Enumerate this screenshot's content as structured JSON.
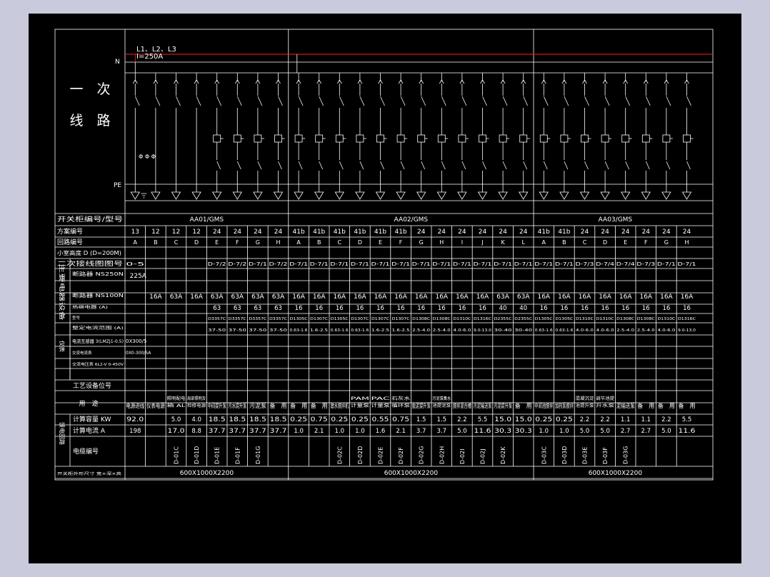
{
  "title_block": {
    "primary_circuit_line1": "一　次",
    "primary_circuit_line2": "线　路",
    "bus_phases": "L1、L2、L3",
    "bus_current": "I=250A",
    "n_label": "N",
    "pe_label": "PE",
    "meter_symbol": "Φ Φ Φ"
  },
  "row_labels": {
    "cabinet_no_type": "开关柜编号/型号",
    "scheme_no": "方案编号",
    "circuit_no": "回路编号",
    "drawer_height": "小室高度 D (D=200M)",
    "secondary_diagram": "二次接线图图号",
    "main_equipment": "主要电器设备",
    "breaker_main": "断路器 NS250N",
    "breaker_feed": "断路器 NS100N",
    "thermal_relay": "热继电器 (A)",
    "contactor": "接触器",
    "contactor_model": "型号",
    "contactor_range": "整定电流范围 (A)",
    "current_transformer": "电流互感器 3(LMZJ1-0.5)",
    "ammeter": "交流电流表",
    "voltmeter": "交流电压表 6L2-V 0-450V",
    "meters_group": "仪表",
    "process_position": "工艺设备位号",
    "usage": "用　途",
    "calc_capacity": "计算容量 KW",
    "calc_current": "计算电流 A",
    "cable_no": "电缆编号",
    "feeder_circuit": "馈电回路",
    "footer_left": "开关柜外形尺寸 宽×深×高"
  },
  "cabinets": [
    {
      "name": "AA01/GMS",
      "dims": "600X1000X2200"
    },
    {
      "name": "AA02/GMS",
      "dims": "600X1000X2200"
    },
    {
      "name": "AA03/GMS",
      "dims": "600X1000X2200"
    }
  ],
  "columns": [
    {
      "scheme": "13",
      "circuit": "A",
      "sec": "0-5",
      "breaker": "225A",
      "nsa": "",
      "relay": "",
      "model": "",
      "range": "",
      "ct": "0X300/5",
      "amm": "0X0-300/5A",
      "usage": "电源进线",
      "kw": "92.0",
      "amp": "198",
      "cable": ""
    },
    {
      "scheme": "12",
      "circuit": "B",
      "sec": "",
      "breaker": "",
      "nsa": "16A",
      "relay": "",
      "model": "",
      "range": "",
      "ct": "",
      "amm": "",
      "usage": "仪表电源",
      "kw": "",
      "amp": "",
      "cable": ""
    },
    {
      "scheme": "12",
      "circuit": "C",
      "sec": "",
      "breaker": "",
      "nsa": "63A",
      "relay": "",
      "model": "",
      "range": "",
      "ct": "",
      "amm": "",
      "usage": "照明配电箱 AL",
      "kw": "5.0",
      "amp": "17.0",
      "cable": "D-01C"
    },
    {
      "scheme": "12",
      "circuit": "D",
      "sec": "",
      "breaker": "",
      "nsa": "16A",
      "relay": "",
      "model": "",
      "range": "",
      "ct": "",
      "amm": "",
      "usage": "局部照明及检修电源",
      "kw": "4.0",
      "amp": "8.8",
      "cable": "D-01D"
    },
    {
      "scheme": "24",
      "circuit": "E",
      "sec": "D-7/2",
      "breaker": "",
      "nsa": "63A",
      "relay": "63",
      "model": "D3357C",
      "range": "37-50",
      "ct": "",
      "amm": "",
      "usage": "中间提升泵",
      "kw": "18.5",
      "amp": "37.7",
      "cable": "D-01E"
    },
    {
      "scheme": "24",
      "circuit": "F",
      "sec": "D-7/2",
      "breaker": "",
      "nsa": "63A",
      "relay": "63",
      "model": "D3357C",
      "range": "37-50",
      "ct": "",
      "amm": "",
      "usage": "污水提升泵",
      "kw": "18.5",
      "amp": "37.7",
      "cable": "D-01F"
    },
    {
      "scheme": "24",
      "circuit": "G",
      "sec": "D-7/1",
      "breaker": "",
      "nsa": "63A",
      "relay": "63",
      "model": "D3357C",
      "range": "37-50",
      "ct": "",
      "amm": "",
      "usage": "污泥泵",
      "kw": "18.5",
      "amp": "37.7",
      "cable": "D-01G"
    },
    {
      "scheme": "24",
      "circuit": "H",
      "sec": "D-7/2",
      "breaker": "",
      "nsa": "63A",
      "relay": "63",
      "model": "D3357C",
      "range": "37-50",
      "ct": "",
      "amm": "",
      "usage": "备　用",
      "kw": "18.5",
      "amp": "37.7",
      "cable": ""
    },
    {
      "scheme": "41b",
      "circuit": "A",
      "sec": "D-7/1",
      "breaker": "",
      "nsa": "16A",
      "relay": "16",
      "model": "D1305C",
      "range": "0.63-1.6",
      "ct": "",
      "amm": "",
      "usage": "备　用",
      "kw": "0.25",
      "amp": "1.0",
      "cable": ""
    },
    {
      "scheme": "41b",
      "circuit": "B",
      "sec": "D-7/1",
      "breaker": "",
      "nsa": "16A",
      "relay": "16",
      "model": "D1307C",
      "range": "1.6-2.5",
      "ct": "",
      "amm": "",
      "usage": "备　用",
      "kw": "0.75",
      "amp": "2.1",
      "cable": ""
    },
    {
      "scheme": "41b",
      "circuit": "C",
      "sec": "D-7/1",
      "breaker": "",
      "nsa": "16A",
      "relay": "16",
      "model": "D1305C",
      "range": "0.63-1.6",
      "ct": "",
      "amm": "",
      "usage": "潜水搅拌机",
      "kw": "0.25",
      "amp": "1.0",
      "cable": "D-02C"
    },
    {
      "scheme": "41b",
      "circuit": "D",
      "sec": "D-7/1",
      "breaker": "",
      "nsa": "16A",
      "relay": "16",
      "model": "D1307C",
      "range": "0.63-1.6",
      "ct": "",
      "amm": "",
      "usage": "PAM计量泵",
      "kw": "0.25",
      "amp": "1.0",
      "cable": "D-02D"
    },
    {
      "scheme": "41b",
      "circuit": "E",
      "sec": "D-7/1",
      "breaker": "",
      "nsa": "16A",
      "relay": "16",
      "model": "D1307C",
      "range": "1.6-2.5",
      "ct": "",
      "amm": "",
      "usage": "PAC计量泵",
      "kw": "0.55",
      "amp": "1.6",
      "cable": "D-02E"
    },
    {
      "scheme": "41b",
      "circuit": "F",
      "sec": "D-7/1",
      "breaker": "",
      "nsa": "16A",
      "relay": "16",
      "model": "D1307C",
      "range": "1.6-2.5",
      "ct": "",
      "amm": "",
      "usage": "石灰水循环泵",
      "kw": "0.75",
      "amp": "2.1",
      "cable": "D-02F"
    },
    {
      "scheme": "24",
      "circuit": "G",
      "sec": "D-7/1",
      "breaker": "",
      "nsa": "16A",
      "relay": "16",
      "model": "D1308C",
      "range": "2.5-4.0",
      "ct": "",
      "amm": "",
      "usage": "脱泥提升泵",
      "kw": "1.5",
      "amp": "3.7",
      "cable": "D-02G"
    },
    {
      "scheme": "24",
      "circuit": "H",
      "sec": "D-7/1",
      "breaker": "",
      "nsa": "16A",
      "relay": "16",
      "model": "D1308C",
      "range": "2.5-4.0",
      "ct": "",
      "amm": "",
      "usage": "污泥泵集水池提泥泵",
      "kw": "1.5",
      "amp": "3.7",
      "cable": "D-02H"
    },
    {
      "scheme": "24",
      "circuit": "I",
      "sec": "D-7/1",
      "breaker": "",
      "nsa": "16A",
      "relay": "16",
      "model": "D1310C",
      "range": "4.0-6.0",
      "ct": "",
      "amm": "",
      "usage": "搅拌混合槽",
      "kw": "2.2",
      "amp": "5.0",
      "cable": "D-02I"
    },
    {
      "scheme": "24",
      "circuit": "J",
      "sec": "D-7/1",
      "breaker": "",
      "nsa": "16A",
      "relay": "16",
      "model": "D1316C",
      "range": "9.0-13.0",
      "ct": "",
      "amm": "",
      "usage": "污泥输送泵",
      "kw": "5.5",
      "amp": "11.6",
      "cable": "D-02J"
    },
    {
      "scheme": "24",
      "circuit": "K",
      "sec": "D-7/1",
      "breaker": "",
      "nsa": "63A",
      "relay": "40",
      "model": "D2355C",
      "range": "30-40",
      "ct": "",
      "amm": "",
      "usage": "污泥提升泵",
      "kw": "15.0",
      "amp": "30.3",
      "cable": "D-02K"
    },
    {
      "scheme": "24",
      "circuit": "L",
      "sec": "D-7/1",
      "breaker": "",
      "nsa": "63A",
      "relay": "40",
      "model": "D2355C",
      "range": "30-40",
      "ct": "",
      "amm": "",
      "usage": "备　用",
      "kw": "15.0",
      "amp": "30.3",
      "cable": ""
    },
    {
      "scheme": "41b",
      "circuit": "A",
      "sec": "D-7/1",
      "breaker": "",
      "nsa": "16A",
      "relay": "16",
      "model": "D1305C",
      "range": "0.63-1.6",
      "ct": "",
      "amm": "",
      "usage": "中间池搅拌",
      "kw": "0.25",
      "amp": "1.0",
      "cable": "D-03C"
    },
    {
      "scheme": "41b",
      "circuit": "B",
      "sec": "D-7/1",
      "breaker": "",
      "nsa": "16A",
      "relay": "16",
      "model": "D1305C",
      "range": "0.63-1.6",
      "ct": "",
      "amm": "",
      "usage": "加药泵搅拌",
      "kw": "0.25",
      "amp": "1.0",
      "cable": "D-03D"
    },
    {
      "scheme": "24",
      "circuit": "C",
      "sec": "D-7/3",
      "breaker": "",
      "nsa": "16A",
      "relay": "16",
      "model": "D1310C",
      "range": "4.0-6.0",
      "ct": "",
      "amm": "",
      "usage": "混凝沉淀池提升泵",
      "kw": "2.2",
      "amp": "5.0",
      "cable": "D-03E"
    },
    {
      "scheme": "24",
      "circuit": "D",
      "sec": "D-7/4",
      "breaker": "",
      "nsa": "16A",
      "relay": "16",
      "model": "D1310C",
      "range": "4.0-6.0",
      "ct": "",
      "amm": "",
      "usage": "调节池提升水泵",
      "kw": "2.2",
      "amp": "5.0",
      "cable": "D-03F"
    },
    {
      "scheme": "24",
      "circuit": "E",
      "sec": "D-7/4",
      "breaker": "",
      "nsa": "16A",
      "relay": "16",
      "model": "D1308C",
      "range": "2.5-4.0",
      "ct": "",
      "amm": "",
      "usage": "泥输送泵",
      "kw": "1.1",
      "amp": "2.7",
      "cable": "D-03G"
    },
    {
      "scheme": "24",
      "circuit": "F",
      "sec": "D-7/3",
      "breaker": "",
      "nsa": "16A",
      "relay": "16",
      "model": "D1308C",
      "range": "2.5-4.0",
      "ct": "",
      "amm": "",
      "usage": "备　用",
      "kw": "1.1",
      "amp": "2.7",
      "cable": ""
    },
    {
      "scheme": "24",
      "circuit": "G",
      "sec": "D-7/1",
      "breaker": "",
      "nsa": "16A",
      "relay": "16",
      "model": "D1310C",
      "range": "4.0-6.0",
      "ct": "",
      "amm": "",
      "usage": "备　用",
      "kw": "2.2",
      "amp": "5.0",
      "cable": ""
    },
    {
      "scheme": "24",
      "circuit": "H",
      "sec": "D-7/1",
      "breaker": "",
      "nsa": "16A",
      "relay": "16",
      "model": "D1316C",
      "range": "9.0-13.0",
      "ct": "",
      "amm": "",
      "usage": "备　用",
      "kw": "5.5",
      "amp": "11.6",
      "cable": ""
    }
  ],
  "colors": {
    "background": "#000000",
    "line": "#ffffff",
    "bus_red": "#ff2020",
    "outer": "#c9cbdd"
  }
}
